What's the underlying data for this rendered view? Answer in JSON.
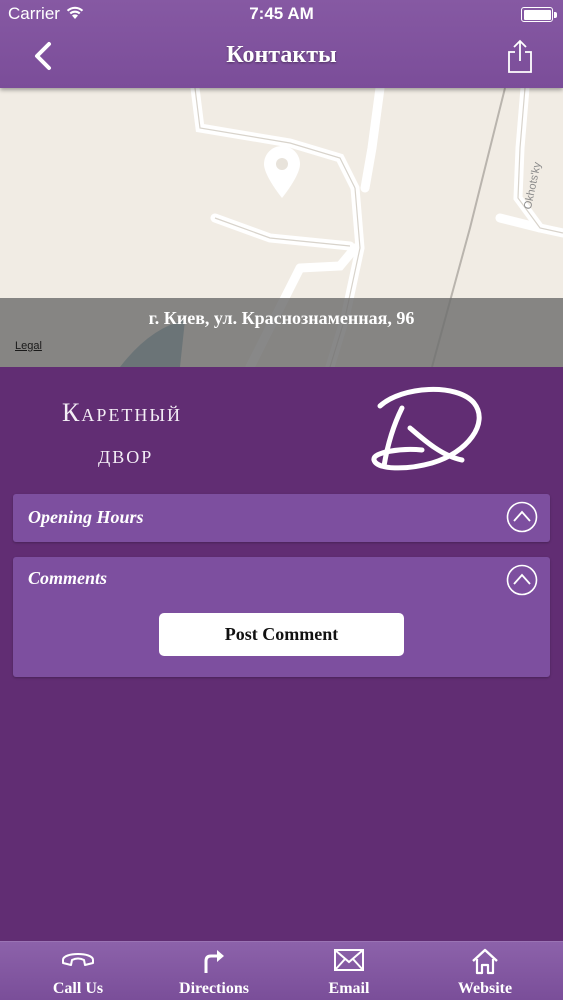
{
  "status_bar": {
    "carrier": "Carrier",
    "time": "7:45 AM"
  },
  "nav": {
    "title": "Контакты"
  },
  "map": {
    "address": "г. Киев, ул. Краснознаменная, 96",
    "legal": "Legal",
    "street_label": "Okhots'ky"
  },
  "logo": {
    "line1": "Каретный",
    "line2": "двор"
  },
  "panels": {
    "opening_hours": {
      "title": "Opening Hours"
    },
    "comments": {
      "title": "Comments",
      "button": "Post Comment"
    }
  },
  "tabbar": {
    "items": [
      {
        "label": "Call Us",
        "icon": "phone-icon"
      },
      {
        "label": "Directions",
        "icon": "directions-icon"
      },
      {
        "label": "Email",
        "icon": "email-icon"
      },
      {
        "label": "Website",
        "icon": "home-icon"
      }
    ]
  },
  "colors": {
    "background": "#612d73",
    "nav": "#8659a3",
    "panel": "#7d4f9f",
    "map_land": "#f1ece4"
  }
}
